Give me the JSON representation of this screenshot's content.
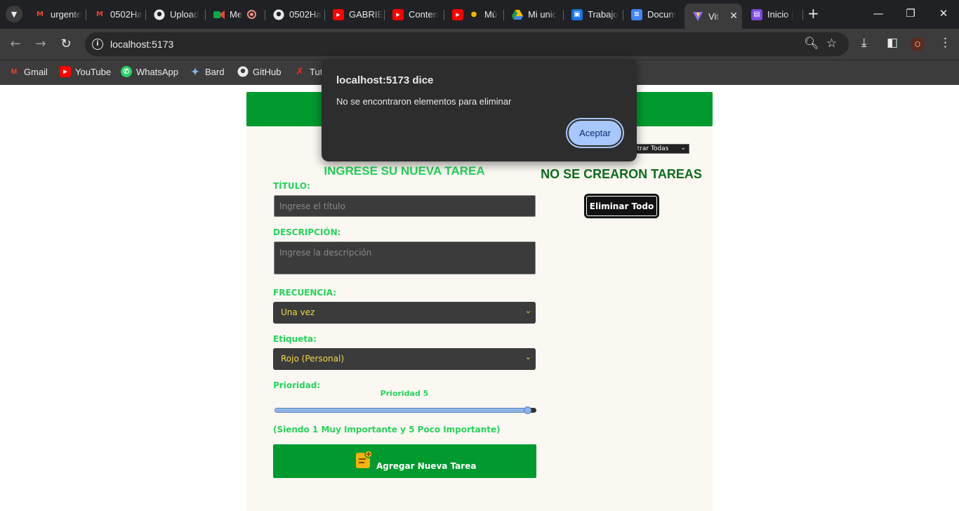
{
  "browser": {
    "tabs": [
      {
        "label": "urgente",
        "icon": "gmail-icon"
      },
      {
        "label": "0502Ha",
        "icon": "gmail-icon"
      },
      {
        "label": "Upload",
        "icon": "github-icon"
      },
      {
        "label": "Me",
        "icon": "meet-icon"
      },
      {
        "label": "0502Ha",
        "icon": "github-icon"
      },
      {
        "label": "GABRIE",
        "icon": "youtube-icon"
      },
      {
        "label": "Conten",
        "icon": "youtube-icon"
      },
      {
        "label": "Mú",
        "icon": "youtube-icon"
      },
      {
        "label": "Mi unic",
        "icon": "drive-icon"
      },
      {
        "label": "Trabajo",
        "icon": "classroom-icon"
      },
      {
        "label": "Docum",
        "icon": "docs-icon"
      },
      {
        "label": "Vit",
        "icon": "vite-icon",
        "active": true
      },
      {
        "label": "Inicio |",
        "icon": "clapper-icon"
      }
    ],
    "url": "localhost:5173",
    "profile_initial": "O",
    "bookmarks": [
      {
        "label": "Gmail",
        "icon": "gmail-icon"
      },
      {
        "label": "YouTube",
        "icon": "youtube-icon"
      },
      {
        "label": "WhatsApp",
        "icon": "whatsapp-icon"
      },
      {
        "label": "Bard",
        "icon": "bard-icon"
      },
      {
        "label": "GitHub",
        "icon": "github-icon"
      },
      {
        "label": "Tut",
        "icon": "tutorial-icon"
      }
    ]
  },
  "form": {
    "title": "INGRESE SU NUEVA TAREA",
    "title_label": "TÍTULO:",
    "title_placeholder": "Ingrese el título",
    "description_label": "DESCRIPCIÓN:",
    "description_placeholder": "Ingrese la descripción",
    "frequency_label": "FRECUENCIA:",
    "frequency_value": "Una vez",
    "tag_label": "Etiqueta:",
    "tag_value": "Rojo (Personal)",
    "priority_label": "Prioridad:",
    "priority_value_text": "Prioridad 5",
    "priority_level": 5,
    "priority_range": [
      1,
      5
    ],
    "priority_note": "(Siendo 1 Muy Importante y 5 Poco Importante)",
    "submit_label": "Agregar Nueva Tarea"
  },
  "tasks": {
    "filter_value": "strar Todas",
    "empty_message": "NO SE CREARON TAREAS",
    "delete_all_label": "Eliminar Todo"
  },
  "dialog": {
    "title": "localhost:5173 dice",
    "message": "No se encontraron elementos para eliminar",
    "accept_label": "Aceptar"
  },
  "colors": {
    "accent_green": "#009a2e",
    "label_green": "#26d35b",
    "dialog_button": "#a8c7fa"
  }
}
